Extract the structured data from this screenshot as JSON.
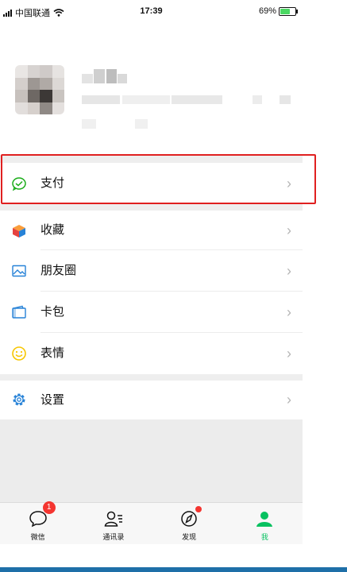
{
  "status_bar": {
    "carrier": "中国联通",
    "time": "17:39",
    "battery": "69%",
    "battery_level": 0.69
  },
  "menu": [
    {
      "label": "支付",
      "icon": "wallet-check-icon"
    },
    {
      "label": "收藏",
      "icon": "cube-icon"
    },
    {
      "label": "朋友圈",
      "icon": "photo-icon"
    },
    {
      "label": "卡包",
      "icon": "card-wallet-icon"
    },
    {
      "label": "表情",
      "icon": "smile-icon"
    },
    {
      "label": "设置",
      "icon": "gear-icon"
    }
  ],
  "tabbar": [
    {
      "label": "微信",
      "icon": "chat-bubble-icon",
      "badge": "1"
    },
    {
      "label": "通讯录",
      "icon": "contacts-icon"
    },
    {
      "label": "发现",
      "icon": "compass-icon"
    },
    {
      "label": "我",
      "icon": "person-icon",
      "active": true
    }
  ],
  "colors": {
    "accent": "#07c160",
    "highlight": "#e02020",
    "badge": "#f43530"
  }
}
